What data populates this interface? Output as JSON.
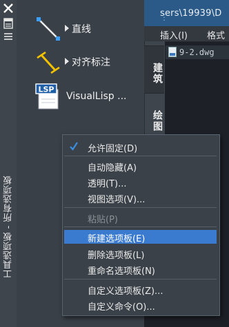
{
  "app": {
    "path_text": "sers\\19939\\D",
    "menu_insert": "插入(I)",
    "menu_format": "格式",
    "doc_tab": "9-2.dwg"
  },
  "palette": {
    "title": "工具选项板 - 所有选项板",
    "tools": [
      {
        "icon": "line-icon",
        "label": "直线"
      },
      {
        "icon": "aligned-dimension-icon",
        "label": "对齐标注"
      },
      {
        "icon": "visuallisp-icon",
        "label": "VisualLisp ...",
        "icon_text": "LSP"
      }
    ],
    "tabs": [
      {
        "label": "建筑"
      },
      {
        "label": "绘图"
      }
    ]
  },
  "context_menu": {
    "items": [
      {
        "label": "允许固定(D)",
        "checked": true,
        "disabled": false,
        "highlighted": false
      },
      {
        "label": "自动隐藏(A)",
        "checked": false,
        "disabled": false,
        "highlighted": false
      },
      {
        "label": "透明(T)...",
        "checked": false,
        "disabled": false,
        "highlighted": false
      },
      {
        "label": "视图选项(V)...",
        "checked": false,
        "disabled": false,
        "highlighted": false
      },
      {
        "label": "粘贴(P)",
        "checked": false,
        "disabled": true,
        "highlighted": false
      },
      {
        "label": "新建选项板(E)",
        "checked": false,
        "disabled": false,
        "highlighted": true
      },
      {
        "label": "删除选项板(L)",
        "checked": false,
        "disabled": false,
        "highlighted": false
      },
      {
        "label": "重命名选项板(N)",
        "checked": false,
        "disabled": false,
        "highlighted": false
      },
      {
        "label": "自定义选项板(Z)...",
        "checked": false,
        "disabled": false,
        "highlighted": false
      },
      {
        "label": "自定义命令(O)...",
        "checked": false,
        "disabled": false,
        "highlighted": false
      }
    ]
  },
  "colors": {
    "highlight": "#3a7bd0",
    "check": "#3a8de0",
    "titlebar_blue": "#2b5a88"
  }
}
